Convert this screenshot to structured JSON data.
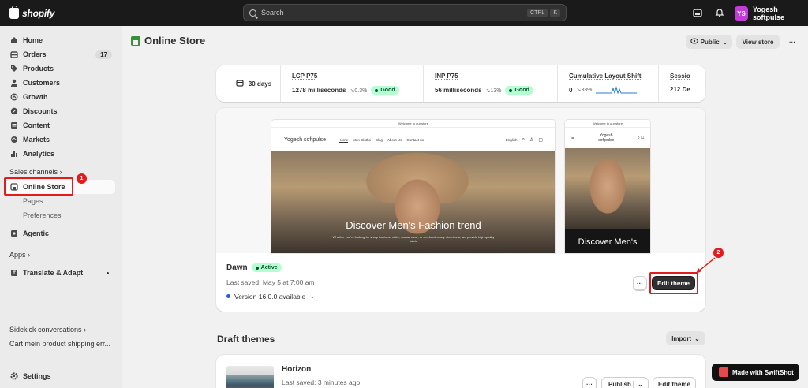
{
  "topbar": {
    "brand": "shopify",
    "search_placeholder": "Search",
    "shortcut_keys": [
      "CTRL",
      "K"
    ],
    "store_initials": "YS",
    "store_name": "Yogesh softpulse"
  },
  "sidebar": {
    "items": [
      {
        "label": "Home",
        "icon": "home-icon"
      },
      {
        "label": "Orders",
        "icon": "orders-icon",
        "count": "17"
      },
      {
        "label": "Products",
        "icon": "tag-icon"
      },
      {
        "label": "Customers",
        "icon": "person-icon"
      },
      {
        "label": "Growth",
        "icon": "growth-icon"
      },
      {
        "label": "Discounts",
        "icon": "discount-icon"
      },
      {
        "label": "Content",
        "icon": "content-icon"
      },
      {
        "label": "Markets",
        "icon": "globe-icon"
      },
      {
        "label": "Analytics",
        "icon": "chart-icon"
      }
    ],
    "sales_channels_label": "Sales channels",
    "online_store_label": "Online Store",
    "sub_items": [
      "Pages",
      "Preferences"
    ],
    "agentic_label": "Agentic",
    "apps_label": "Apps",
    "translate_label": "Translate & Adapt",
    "sidekick_label": "Sidekick conversations",
    "sidekick_item": "Cart mein product shipping err...",
    "settings_label": "Settings"
  },
  "header": {
    "title": "Online Store",
    "visibility_label": "Public",
    "view_store_label": "View store",
    "more_label": "···"
  },
  "metrics": {
    "date_range": "30 days",
    "cells": [
      {
        "title": "LCP P75",
        "value": "1278 milliseconds",
        "change": "0.3%",
        "status": "Good"
      },
      {
        "title": "INP P75",
        "value": "56 milliseconds",
        "change": "13%",
        "status": "Good"
      },
      {
        "title": "Cumulative Layout Shift",
        "value": "0",
        "change": "33%"
      },
      {
        "title": "Sessio",
        "value": "212 De"
      }
    ]
  },
  "preview": {
    "announcement": "Welcome to our store",
    "store_name": "Yogesh softpulse",
    "store_name_mobile_1": "Yogesh",
    "store_name_mobile_2": "softpulse",
    "nav_links": [
      "Home",
      "Men Cloths",
      "Blog",
      "About Us",
      "Contact us"
    ],
    "language": "English",
    "hero_title": "Discover Men's Fashion trend",
    "hero_title_mobile": "Discover Men's",
    "hero_sub": "Whether you're looking for sharp business attire, casual wear, or weekend-ready streetwear, we provide high-quality fabric"
  },
  "current_theme": {
    "name": "Dawn",
    "status": "Active",
    "last_saved": "Last saved: May 5 at 7:00 am",
    "version": "Version 16.0.0 available",
    "edit_label": "Edit theme",
    "more_label": "···"
  },
  "annotations": {
    "one": "1",
    "two": "2"
  },
  "drafts": {
    "title": "Draft themes",
    "import_label": "Import",
    "items": [
      {
        "name": "Horizon",
        "last_saved": "Last saved: 3 minutes ago",
        "publish_label": "Publish",
        "edit_label": "Edit theme",
        "more_label": "···"
      }
    ]
  },
  "watermark": "Made with SwiftShot",
  "colors": {
    "accent_red": "#e31b1b",
    "good_bg": "#b4fed2",
    "avatar": "#c33cd8"
  }
}
